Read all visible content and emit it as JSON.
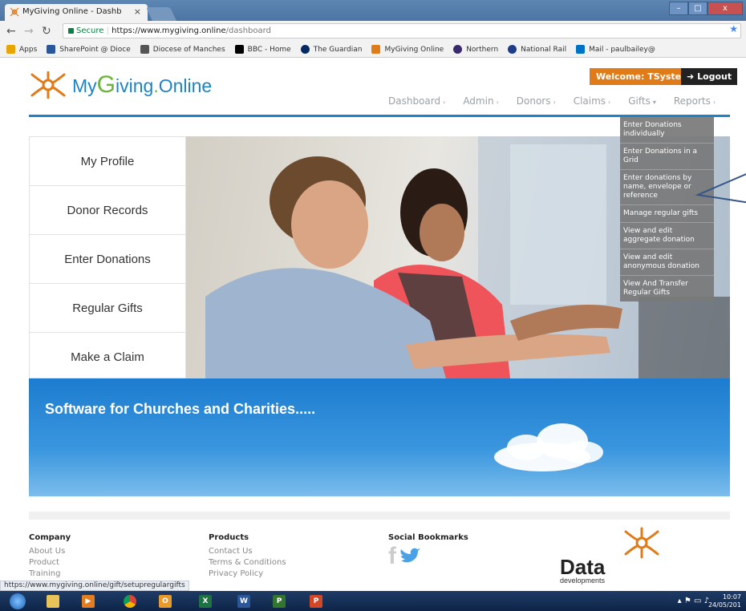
{
  "browser": {
    "tab_title": "MyGiving Online - Dashb",
    "tab_close": "×",
    "secure_label": "Secure",
    "url_host": "https://www.mygiving.online",
    "url_path": "/dashboard",
    "window_min": "–",
    "window_max": "□",
    "window_close": "x",
    "status_url": "https://www.mygiving.online/gift/setupregulargifts"
  },
  "bookmarks": [
    {
      "label": "Apps",
      "color": "#e8a400"
    },
    {
      "label": "SharePoint @ Dioce",
      "color": "#2b579a"
    },
    {
      "label": "Diocese of Manches",
      "color": "#555555"
    },
    {
      "label": "BBC - Home",
      "color": "#000000"
    },
    {
      "label": "The Guardian",
      "color": "#052962"
    },
    {
      "label": "MyGiving Online",
      "color": "#e07b1a"
    },
    {
      "label": "Northern",
      "color": "#3b2a6b"
    },
    {
      "label": "National Rail",
      "color": "#1f3c88"
    },
    {
      "label": "Mail - paulbailey@",
      "color": "#0072c6"
    }
  ],
  "header": {
    "logo_my": "My",
    "logo_g": "G",
    "logo_iving": "iving",
    "logo_dot": ".",
    "logo_online": "Online",
    "welcome_label": "Welcome:",
    "welcome_user": "TSystem",
    "logout_label": "Logout"
  },
  "nav": {
    "items": [
      {
        "label": "Dashboard",
        "caret": "›"
      },
      {
        "label": "Admin",
        "caret": "›"
      },
      {
        "label": "Donors",
        "caret": "›"
      },
      {
        "label": "Claims",
        "caret": "›"
      },
      {
        "label": "Gifts",
        "caret": "▾"
      },
      {
        "label": "Reports",
        "caret": "›"
      }
    ]
  },
  "gifts_menu": {
    "items": [
      "Enter Donations individually",
      "Enter Donations in a Grid",
      "Enter donations by name, envelope or reference",
      "Manage regular gifts",
      "View and edit aggregate donation",
      "View and edit anonymous donation",
      "View And Transfer Regular Gifts"
    ]
  },
  "side_menu": {
    "items": [
      "My Profile",
      "Donor Records",
      "Enter Donations",
      "Regular Gifts",
      "Make a Claim"
    ]
  },
  "banner": {
    "text": "Software for Churches and Charities....."
  },
  "footer": {
    "company_title": "Company",
    "company_links": [
      "About Us",
      "Product",
      "Training"
    ],
    "products_title": "Products",
    "products_links": [
      "Contact Us",
      "Terms & Conditions",
      "Privacy Policy"
    ],
    "social_title": "Social Bookmarks",
    "brand_word": "Data",
    "brand_sub": "developments"
  },
  "taskbar": {
    "time": "10:07",
    "date": "24/05/201"
  }
}
